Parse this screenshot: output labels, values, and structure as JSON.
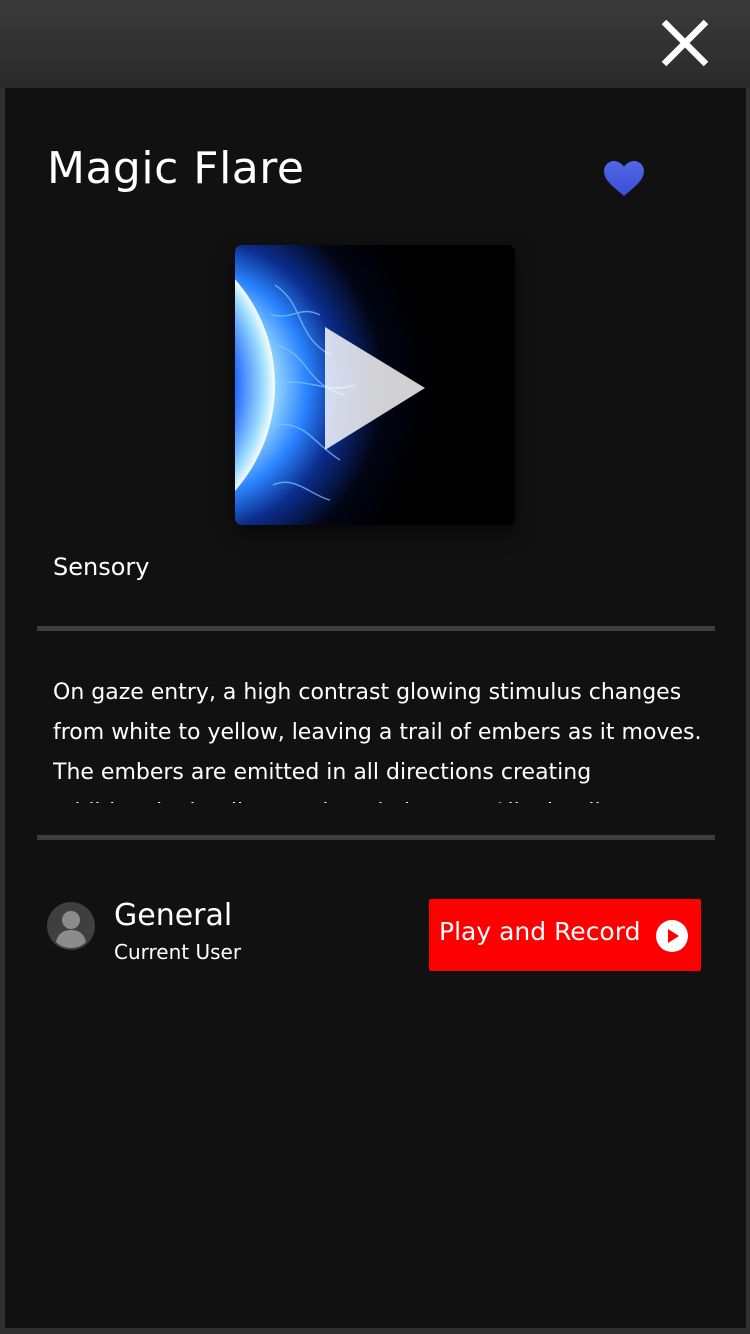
{
  "window": {
    "close_icon": "close-icon"
  },
  "activity": {
    "title": "Magic Flare",
    "favorite_icon": "heart-icon",
    "favorite_color": "#4a5ce0",
    "thumbnail_icon": "play-triangle-icon",
    "category": "Sensory",
    "description": "On gaze entry, a high contrast glowing stimulus changes from white to yellow, leaving a trail of embers as it moves. The embers are emitted in all directions creating additional stimuli to track and observe. All stimuli"
  },
  "user": {
    "avatar_icon": "user-avatar-icon",
    "name": "General",
    "role": "Current User"
  },
  "actions": {
    "play_record_label": "Play and Record",
    "play_record_icon": "play-circle-icon",
    "play_record_color": "#ff0000"
  }
}
